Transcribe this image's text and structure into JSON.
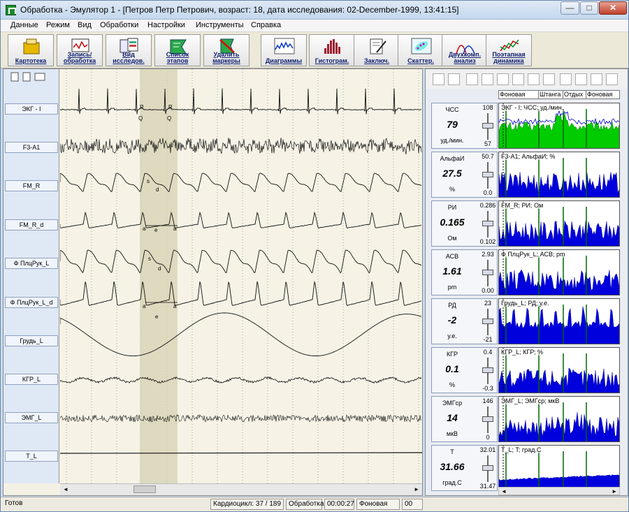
{
  "window": {
    "title": "Обработка - Эмулятор 1 - [Петров Петр Петрович, возраст: 18, дата исследования: 02-December-1999, 13:41:15]",
    "minimize_glyph": "—",
    "maximize_glyph": "□",
    "close_glyph": "✕"
  },
  "menu": [
    "Данные",
    "Режим",
    "Вид",
    "Обработки",
    "Настройки",
    "Инструменты",
    "Справка"
  ],
  "toolbar": [
    {
      "label": "Картотека",
      "icon": "card-file-icon"
    },
    {
      "label": "Запись/ обработка",
      "icon": "record-icon"
    },
    {
      "label": "Вид исследов.",
      "icon": "study-view-icon"
    },
    {
      "label": "Список этапов",
      "icon": "stage-list-icon"
    },
    {
      "label": "Удалить маркеры",
      "icon": "delete-markers-icon"
    },
    {
      "label": "Диаграммы",
      "icon": "diagram-icon"
    },
    {
      "label": "Гистограм.",
      "icon": "histogram-icon"
    },
    {
      "label": "Заключ.",
      "icon": "conclusion-icon"
    },
    {
      "label": "Скаттер.",
      "icon": "scatter-icon"
    },
    {
      "label": "Двухкомп. анализ",
      "icon": "two-component-icon"
    },
    {
      "label": "Поэтапная динамика",
      "icon": "stage-dynamics-icon"
    }
  ],
  "channels": [
    "ЭКГ - I",
    "F3-A1",
    "FM_R",
    "FM_R_d",
    "Ф ПлцРук_L",
    "Ф ПлцРук_L_d",
    "Грудь_L",
    "КГР_L",
    "ЭМГ_L",
    "T_L"
  ],
  "markers": {
    "ecg": [
      "R",
      "Q",
      "R",
      "Q"
    ],
    "fmr": [
      "s",
      "d"
    ],
    "fmrd": [
      "a",
      "e",
      "a"
    ],
    "fpl": [
      "s",
      "d"
    ],
    "fpld": [
      "a",
      "e",
      "a"
    ]
  },
  "stage_tabs": [
    "Фоновая",
    "Штанга",
    "Отдых",
    "Фоновая"
  ],
  "params": [
    {
      "name": "ЧСС",
      "value": "79",
      "unit": "уд./мин.",
      "max": "108",
      "min": "57",
      "trend": "ЭКГ - I; ЧСС; уд./мин.",
      "color": "#00cc00"
    },
    {
      "name": "АльфаИ",
      "value": "27.5",
      "unit": "%",
      "max": "50.7",
      "min": "0.0",
      "trend": "F3-A1; АльфаИ; %",
      "color": "#0000dd"
    },
    {
      "name": "РИ",
      "value": "0.165",
      "unit": "Ом",
      "max": "0.286",
      "min": "0.102",
      "trend": "FM_R; РИ; Ом",
      "color": "#0000dd"
    },
    {
      "name": "АСВ",
      "value": "1.61",
      "unit": "pm",
      "max": "2.93",
      "min": "0.00",
      "trend": "Ф ПлцРук_L; АСВ; pm",
      "color": "#0000dd"
    },
    {
      "name": "РД",
      "value": "-2",
      "unit": "у.е.",
      "max": "23",
      "min": "-21",
      "trend": "Грудь_L; РД; у.е.",
      "color": "#0000dd"
    },
    {
      "name": "КГР",
      "value": "0.1",
      "unit": "%",
      "max": "0.4",
      "min": "-0.3",
      "trend": "КГР_L; КГР; %",
      "color": "#0000dd"
    },
    {
      "name": "ЭМГср",
      "value": "14",
      "unit": "мкВ",
      "max": "146",
      "min": "0",
      "trend": "ЭМГ_L; ЭМГср; мкВ",
      "color": "#0000dd"
    },
    {
      "name": "T",
      "value": "31.66",
      "unit": "град.С",
      "max": "32.01",
      "min": "31.47",
      "trend": "T_L; T; град.С",
      "color": "#0000dd"
    }
  ],
  "status": {
    "ready": "Готов",
    "cardiocycle": "Кардиоцикл: 37 / 189",
    "mode": "Обработка",
    "time": "00:00:27",
    "stage": "Фоновая",
    "extra": "00"
  }
}
